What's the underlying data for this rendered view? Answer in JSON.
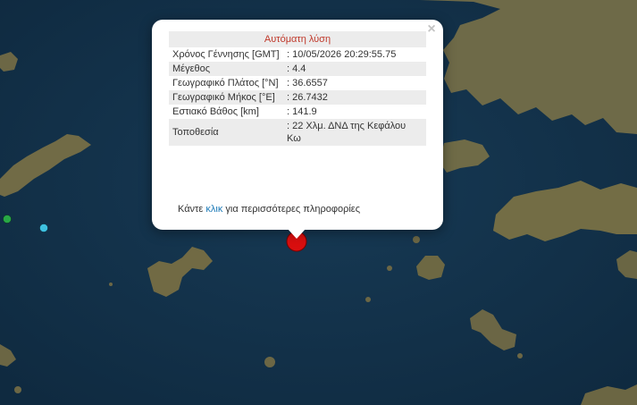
{
  "popup": {
    "title": "Αυτόματη λύση",
    "close_symbol": "×",
    "rows": [
      {
        "label": "Χρόνος Γέννησης [GMT]",
        "value": ": 10/05/2026 20:29:55.75"
      },
      {
        "label": "Μέγεθος",
        "value": ": 4.4"
      },
      {
        "label": "Γεωγραφικό Πλάτος [°N]",
        "value": ": 36.6557"
      },
      {
        "label": "Γεωγραφικό Μήκος [°E]",
        "value": ": 26.7432"
      },
      {
        "label": "Εστιακό Βάθος [km]",
        "value": ": 141.9"
      },
      {
        "label": "Τοποθεσία",
        "value": ": 22 Χλμ. ΔΝΔ της Κεφάλου Κω"
      }
    ],
    "more_prefix": "Κάντε",
    "more_link": "κλικ",
    "more_suffix": "για περισσότερες πληροφορίες"
  },
  "map": {
    "sea_color": "#13314a",
    "land_color": "#6e6a48",
    "marker_color": "#d90f0f",
    "marker_icon": "earthquake-marker",
    "other_markers": [
      {
        "icon": "earthquake-marker-green",
        "color": "#28a745"
      },
      {
        "icon": "earthquake-marker-cyan",
        "color": "#3ec1e0"
      }
    ]
  }
}
